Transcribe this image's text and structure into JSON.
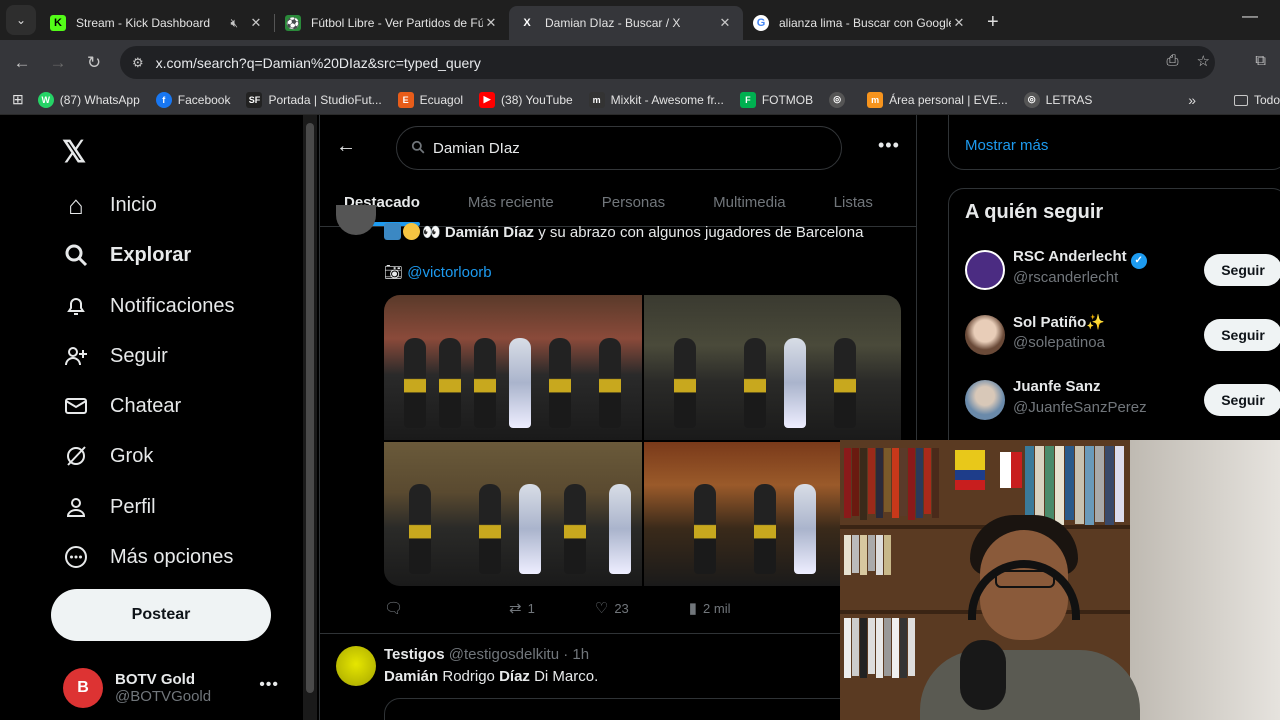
{
  "browser": {
    "tabs": [
      {
        "title": "Stream - Kick Dashboard",
        "favicon_color": "#53fc18",
        "favicon_glyph": "K",
        "muted": true
      },
      {
        "title": "Fútbol Libre - Ver Partidos de Fútbol",
        "favicon_color": "#2a8a3a",
        "favicon_glyph": "⚽"
      },
      {
        "title": "Damian DIaz - Buscar / X",
        "favicon_color": "#000000",
        "favicon_glyph": "X",
        "active": true
      },
      {
        "title": "alianza lima - Buscar con Google",
        "favicon_color": "#ffffff",
        "favicon_glyph": "G"
      }
    ],
    "url": "x.com/search?q=Damian%20DIaz&src=typed_query",
    "bookmarks": [
      {
        "label": "(87) WhatsApp",
        "color": "#25d366",
        "glyph": "W"
      },
      {
        "label": "Facebook",
        "color": "#1877f2",
        "glyph": "f"
      },
      {
        "label": "Portada | StudioFut...",
        "color": "#222222",
        "glyph": "SF"
      },
      {
        "label": "Ecuagol",
        "color": "#e85d1a",
        "glyph": "E"
      },
      {
        "label": "(38) YouTube",
        "color": "#ff0000",
        "glyph": "▶"
      },
      {
        "label": "Mixkit - Awesome fr...",
        "color": "#333333",
        "glyph": "m"
      },
      {
        "label": "FOTMOB",
        "color": "#00b050",
        "glyph": "F"
      },
      {
        "label": "",
        "color": "#555555",
        "glyph": "◎"
      },
      {
        "label": "Área personal | EVE...",
        "color": "#f7941d",
        "glyph": "m"
      },
      {
        "label": "LETRAS",
        "color": "#555555",
        "glyph": "◎"
      }
    ],
    "bookmarks_folder": "Todo"
  },
  "sidebar": {
    "nav": [
      {
        "label": "Inicio",
        "icon": "home-icon",
        "glyph": "⌂",
        "bold": false
      },
      {
        "label": "Explorar",
        "icon": "search-icon",
        "glyph": "⚲",
        "bold": true
      },
      {
        "label": "Notificaciones",
        "icon": "bell-icon",
        "glyph": "♫",
        "bold": false
      },
      {
        "label": "Seguir",
        "icon": "follow-icon",
        "glyph": "♙",
        "bold": false
      },
      {
        "label": "Chatear",
        "icon": "mail-icon",
        "glyph": "✉",
        "bold": false
      },
      {
        "label": "Grok",
        "icon": "grok-icon",
        "glyph": "⊘",
        "bold": false
      },
      {
        "label": "Perfil",
        "icon": "profile-icon",
        "glyph": "♙",
        "bold": false
      },
      {
        "label": "Más opciones",
        "icon": "more-icon",
        "glyph": "⋯",
        "bold": false
      }
    ],
    "post_label": "Postear",
    "account": {
      "name": "BOTV Gold",
      "handle": "@BOTVGoold"
    }
  },
  "search": {
    "query": "Damian DIaz",
    "tabs": [
      "Destacado",
      "Más reciente",
      "Personas",
      "Multimedia",
      "Listas"
    ],
    "active_tab": "Destacado"
  },
  "tweet1": {
    "text_bold": "Damián Díaz",
    "text_rest": " y su abrazo con algunos jugadores de Barcelona",
    "mention": "@victorloorb",
    "replies": "",
    "retweets": "1",
    "likes": "23",
    "views": "2 mil"
  },
  "tweet2": {
    "name": "Testigos",
    "handle": "@testigosdelkitu",
    "time": "· 1h",
    "text_b1": "Damián",
    "text_m1": " Rodrigo ",
    "text_b2": "Díaz",
    "text_m2": " Di Marco."
  },
  "right": {
    "show_more": "Mostrar más",
    "follow_title": "A quién seguir",
    "follow_button": "Seguir",
    "suggestions": [
      {
        "name": "RSC Anderlecht",
        "handle": "@rscanderlecht",
        "verified": true,
        "avatar_color": "#4b2c82"
      },
      {
        "name": "Sol Patiño✨",
        "handle": "@solepatinoa",
        "verified": false,
        "avatar_color": "#c9a892"
      },
      {
        "name": "Juanfe Sanz",
        "handle": "@JuanfeSanzPerez",
        "verified": false,
        "avatar_color": "#6a8aaa"
      }
    ]
  }
}
